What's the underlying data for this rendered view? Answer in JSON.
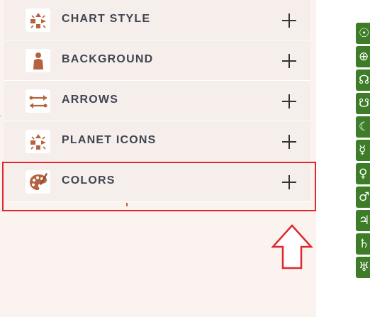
{
  "accordion": {
    "items": [
      {
        "label": "CHART STYLE",
        "icon": "shapes-icon"
      },
      {
        "label": "BACKGROUND",
        "icon": "person-silhouette-icon"
      },
      {
        "label": "ARROWS",
        "icon": "arrows-icon"
      },
      {
        "label": "PLANET ICONS",
        "icon": "shapes-icon"
      },
      {
        "label": "COLORS",
        "icon": "palette-icon"
      }
    ]
  },
  "planet_glyphs": [
    "☉",
    "⊕",
    "☊",
    "☋",
    "☾",
    "☿",
    "♀",
    "♂",
    "♃",
    "♄",
    "♅"
  ],
  "colors": {
    "accent": "#b5633f",
    "highlight": "#e0282c",
    "glyph_bg": "#3e7d28",
    "panel_bg": "#fbf3ef",
    "item_bg": "#f5eeea"
  }
}
